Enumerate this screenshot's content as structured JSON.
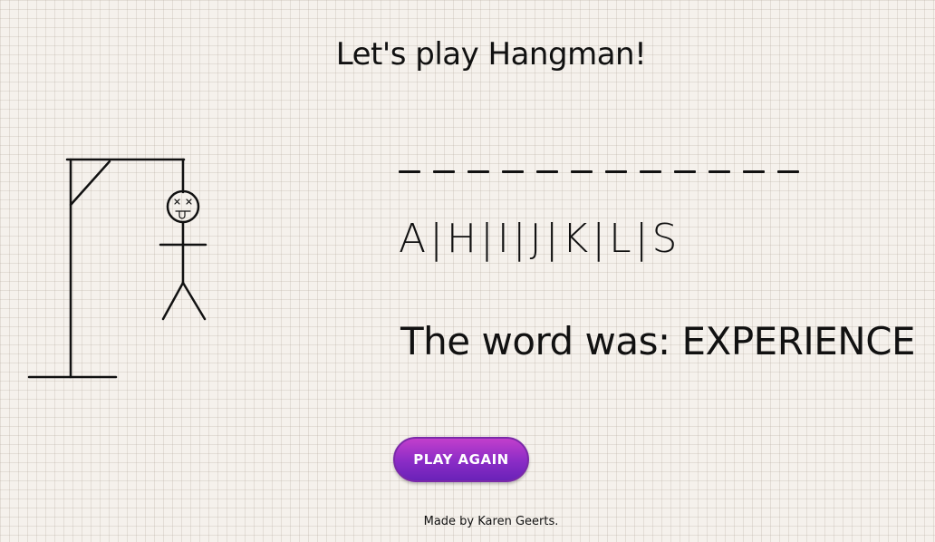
{
  "title": "Let's play Hangman!",
  "word_blank_count": 12,
  "guessed_letters": "A|H|I|J|K|L|S",
  "result": {
    "text": "The word was: EXPERIENCE"
  },
  "play_button": {
    "label": "PLAY AGAIN"
  },
  "footer": {
    "text": "Made by Karen Geerts."
  },
  "colors": {
    "background": "#f5f1ec",
    "ink": "#111111",
    "button_top": "#c23fcc",
    "button_bottom": "#6a22b8"
  },
  "hangman": {
    "state": "complete",
    "face": "dead"
  }
}
